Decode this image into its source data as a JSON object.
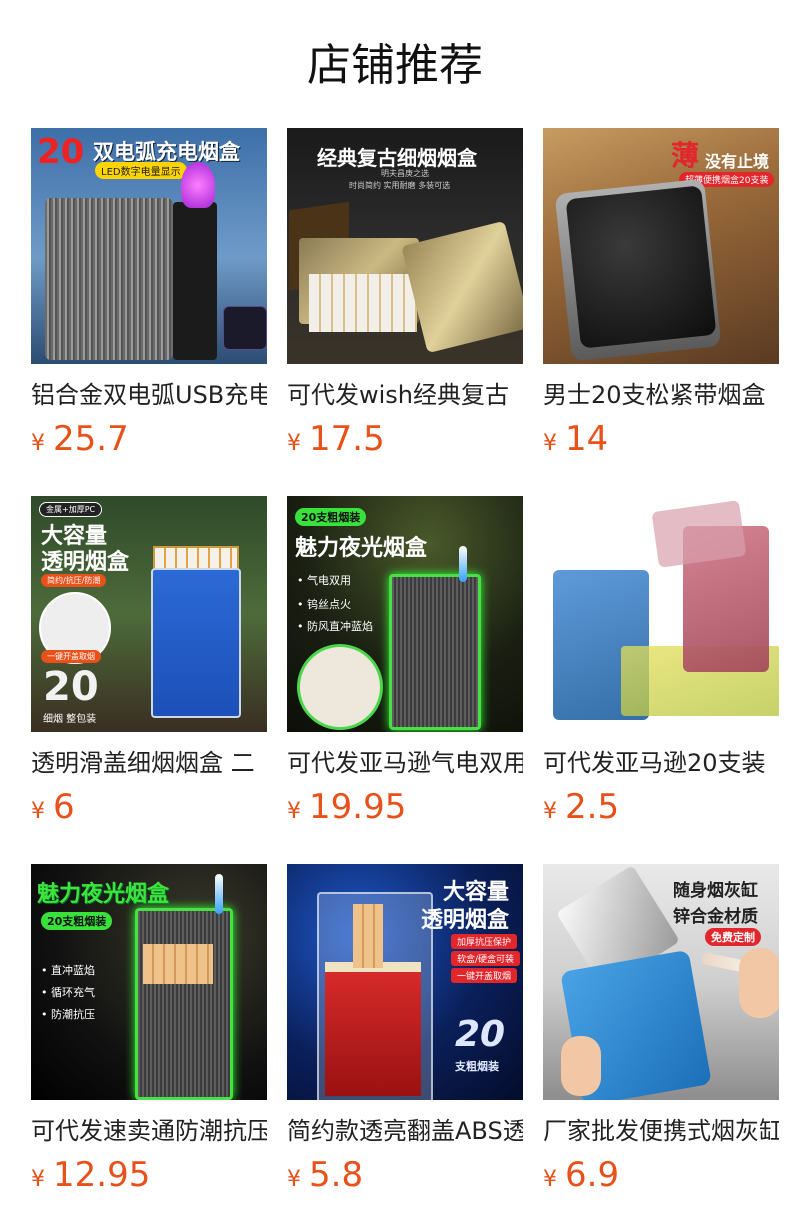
{
  "header": {
    "title": "店铺推荐"
  },
  "currency": "¥",
  "products": [
    {
      "name": "铝合金双电弧USB充电",
      "price": "25.7",
      "img_texts": {
        "num": "20",
        "head": "双电弧充电烟盒",
        "sub": "LED数字电量显示"
      }
    },
    {
      "name": "可代发wish经典复古",
      "price": "17.5",
      "img_texts": {
        "head": "经典复古细烟烟盒",
        "sub": "明夫昌庚之选",
        "sub2": "时尚简约 实用耐磨 多装可选"
      }
    },
    {
      "name": "男士20支松紧带烟盒",
      "price": "14",
      "img_texts": {
        "head1": "薄",
        "head2": "没有止境",
        "sub": "超薄便携烟盒20支装"
      }
    },
    {
      "name": "透明滑盖细烟烟盒 二",
      "price": "6",
      "img_texts": {
        "tag": "金属+加厚PC",
        "head1": "大容量",
        "head2": "透明烟盒",
        "sub": "简约/抗压/防潮",
        "btn": "一键开盖取烟",
        "num": "20",
        "foot": "细烟 整包装"
      }
    },
    {
      "name": "可代发亚马逊气电双用",
      "price": "19.95",
      "img_texts": {
        "tag": "20支粗烟装",
        "head": "魅力夜光烟盒",
        "b1": "• 气电双用",
        "b2": "• 钨丝点火",
        "b3": "• 防风直冲蓝焰"
      }
    },
    {
      "name": "可代发亚马逊20支装",
      "price": "2.5",
      "img_texts": {}
    },
    {
      "name": "可代发速卖通防潮抗压",
      "price": "12.95",
      "img_texts": {
        "head": "魅力夜光烟盒",
        "tag": "20支粗烟装",
        "b1": "• 直冲蓝焰",
        "b2": "• 循环充气",
        "b3": "• 防潮抗压"
      }
    },
    {
      "name": "简约款透亮翻盖ABS透明",
      "price": "5.8",
      "img_texts": {
        "head1": "大容量",
        "head2": "透明烟盒",
        "p1": "加厚抗压保护",
        "p2": "软盒/硬盒可装",
        "p3": "一键开盖取烟",
        "num": "20",
        "foot": "支粗烟装"
      }
    },
    {
      "name": "厂家批发便携式烟灰缸",
      "price": "6.9",
      "img_texts": {
        "head1": "随身烟灰缸",
        "head2": "锌合金材质",
        "btn": "免费定制"
      }
    }
  ],
  "colors": {
    "price": "#e8511a",
    "title": "#111111",
    "name": "#222222"
  }
}
